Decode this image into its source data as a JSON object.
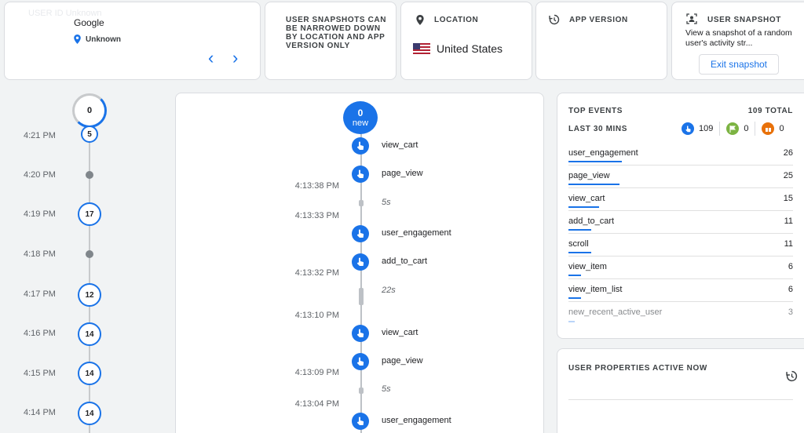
{
  "device_card": {
    "name": "Google",
    "location_label": "Unknown",
    "prev_label": "‹",
    "next_label": "›",
    "ghost_text": "USER ID  Unknown"
  },
  "info_card": {
    "text": "USER SNAPSHOTS CAN BE NARROWED DOWN BY LOCATION AND APP VERSION ONLY"
  },
  "location_card": {
    "title": "LOCATION",
    "value": "United States"
  },
  "app_version_card": {
    "title": "APP VERSION"
  },
  "snapshot_card": {
    "title": "USER SNAPSHOT",
    "description": "View a snapshot of a random user's activity str...",
    "exit_label": "Exit snapshot"
  },
  "minute_timeline": {
    "top_count": "0",
    "rows": [
      {
        "time": "4:21 PM",
        "count": "5"
      },
      {
        "time": "4:20 PM",
        "count": ""
      },
      {
        "time": "4:19 PM",
        "count": "17"
      },
      {
        "time": "4:18 PM",
        "count": ""
      },
      {
        "time": "4:17 PM",
        "count": "12"
      },
      {
        "time": "4:16 PM",
        "count": "14"
      },
      {
        "time": "4:15 PM",
        "count": "14"
      },
      {
        "time": "4:14 PM",
        "count": "14"
      }
    ]
  },
  "event_stream": {
    "new_count": "0",
    "new_label": "new",
    "items": [
      {
        "type": "event",
        "label": "view_cart"
      },
      {
        "type": "event",
        "label": "page_view"
      },
      {
        "type": "time",
        "label": "4:13:38 PM"
      },
      {
        "type": "gap",
        "label": "5s"
      },
      {
        "type": "time",
        "label": "4:13:33 PM"
      },
      {
        "type": "event",
        "label": "user_engagement"
      },
      {
        "type": "event",
        "label": "add_to_cart"
      },
      {
        "type": "time",
        "label": "4:13:32 PM"
      },
      {
        "type": "gap",
        "label": "22s"
      },
      {
        "type": "time",
        "label": "4:13:10 PM"
      },
      {
        "type": "event",
        "label": "view_cart"
      },
      {
        "type": "event",
        "label": "page_view"
      },
      {
        "type": "time",
        "label": "4:13:09 PM"
      },
      {
        "type": "gap",
        "label": "5s"
      },
      {
        "type": "time",
        "label": "4:13:04 PM"
      },
      {
        "type": "event",
        "label": "user_engagement"
      }
    ]
  },
  "top_events": {
    "title": "TOP EVENTS",
    "total": "109 TOTAL",
    "period": "LAST 30 MINS",
    "stat_blue": "109",
    "stat_green": "0",
    "stat_red": "0",
    "rows": [
      {
        "name": "user_engagement",
        "count": "26",
        "share": 0.24
      },
      {
        "name": "page_view",
        "count": "25",
        "share": 0.23
      },
      {
        "name": "view_cart",
        "count": "15",
        "share": 0.14
      },
      {
        "name": "add_to_cart",
        "count": "11",
        "share": 0.1
      },
      {
        "name": "scroll",
        "count": "11",
        "share": 0.1
      },
      {
        "name": "view_item",
        "count": "6",
        "share": 0.06
      },
      {
        "name": "view_item_list",
        "count": "6",
        "share": 0.06
      },
      {
        "name": "new_recent_active_user",
        "count": "3",
        "share": 0.03
      }
    ]
  },
  "user_properties": {
    "title": "USER PROPERTIES ACTIVE NOW"
  },
  "colors": {
    "accent": "#1a73e8",
    "green": "#7cb342",
    "red": "#e8710a"
  }
}
